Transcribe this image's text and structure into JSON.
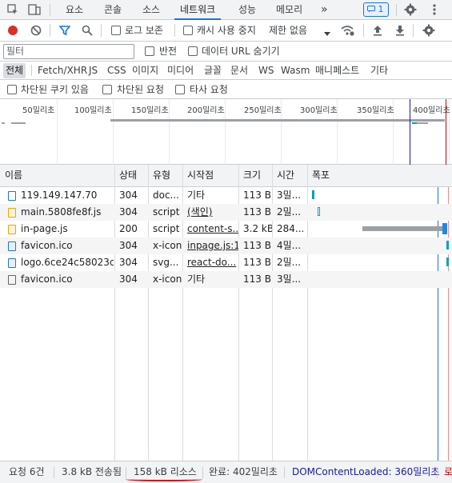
{
  "tabs": [
    {
      "label": "요소"
    },
    {
      "label": "콘솔"
    },
    {
      "label": "소스"
    },
    {
      "label": "네트워크"
    },
    {
      "label": "성능"
    },
    {
      "label": "메모리"
    }
  ],
  "more_tabs": "»",
  "issues_badge": "1",
  "toolbar": {
    "preserve_log": "로그 보존",
    "disable_cache": "캐시 사용 중지",
    "throttling": "제한 없음"
  },
  "filter": {
    "placeholder": "필터",
    "invert": "반전",
    "hide_data_urls": "데이터 URL 숨기기"
  },
  "types": [
    "전체",
    "Fetch/XHR",
    "JS",
    "CSS",
    "이미지",
    "미디어",
    "글꼴",
    "문서",
    "WS",
    "Wasm",
    "매니페스트",
    "기타"
  ],
  "cookies": {
    "blocked_cookies": "차단된 쿠키 있음",
    "blocked_requests": "차단된 요청",
    "third_party": "타사 요청"
  },
  "overview_ticks": [
    "50밀리초",
    "100밀리초",
    "150밀리초",
    "200밀리초",
    "250밀리초",
    "300밀리초",
    "350밀리초",
    "400밀리초"
  ],
  "columns": {
    "name": "이름",
    "status": "상태",
    "type": "유형",
    "initiator": "시작점",
    "size": "크기",
    "time": "시간",
    "waterfall": "폭포"
  },
  "rows": [
    {
      "name": "119.149.147.70",
      "status": "304",
      "type": "doc...",
      "initiator": "기타",
      "size": "113 B",
      "time": "3밀...",
      "icon": "document-icon",
      "link": false,
      "waterfall": [
        0.02,
        0.03
      ]
    },
    {
      "name": "main.5808fe8f.js",
      "status": "304",
      "type": "script",
      "initiator": "(색인)",
      "size": "113 B",
      "time": "2밀...",
      "icon": "script-icon",
      "link": true,
      "waterfall": [
        0.06,
        0.07
      ]
    },
    {
      "name": "in-page.js",
      "status": "200",
      "type": "script",
      "initiator": "content-s...",
      "size": "3.2 kB",
      "time": "284...",
      "icon": "script-icon",
      "link": true,
      "waterfall": [
        0.27,
        0.99
      ]
    },
    {
      "name": "favicon.ico",
      "status": "304",
      "type": "x-icon",
      "initiator": "inpage.js:1",
      "size": "113 B",
      "time": "4밀...",
      "icon": "image-icon",
      "link": true,
      "waterfall": [
        0.98,
        0.99
      ]
    },
    {
      "name": "logo.6ce24c58023c...",
      "status": "304",
      "type": "svg...",
      "initiator": "react-do...",
      "size": "113 B",
      "time": "2밀...",
      "icon": "image-icon",
      "link": true,
      "waterfall": [
        0.98,
        0.99
      ]
    },
    {
      "name": "favicon.ico",
      "status": "304",
      "type": "x-icon",
      "initiator": "기타",
      "size": "113 B",
      "time": "3밀...",
      "icon": "blank-icon",
      "link": false,
      "waterfall": null
    }
  ],
  "status": {
    "requests": "요청 6건",
    "transferred": "3.8 kB 전송됨",
    "resources": "158 kB 리소스",
    "finish": "완료: 402밀리초",
    "dcl": "DOMContentLoaded: 360밀리초",
    "load": "로"
  },
  "colors": {
    "accent": "#1a73e8",
    "record": "#d93025",
    "dcl": "#1a1aa6",
    "load": "#c80000"
  }
}
